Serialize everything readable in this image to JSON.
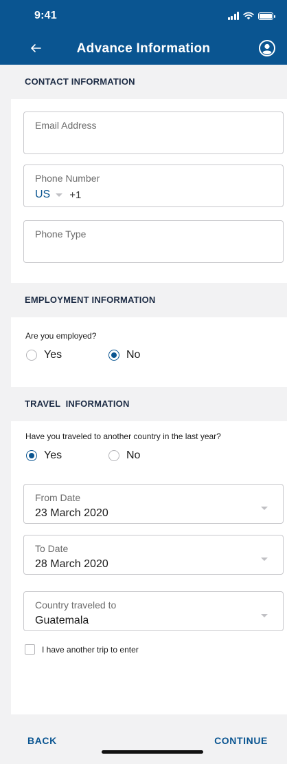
{
  "status_bar": {
    "time": "9:41"
  },
  "app_bar": {
    "title": "Advance Information"
  },
  "contact": {
    "title": "CONTACT INFORMATION",
    "email_label": "Email Address",
    "phone_label": "Phone Number",
    "country_code": "US",
    "dial_code": "+1",
    "phone_type_label": "Phone Type"
  },
  "employment": {
    "title": "EMPLOYMENT INFORMATION",
    "question": "Are you employed?",
    "options": [
      {
        "label": "Yes",
        "checked": false
      },
      {
        "label": "No",
        "checked": true
      }
    ]
  },
  "travel": {
    "title": "TRAVEL  INFORMATION",
    "question": "Have you traveled to another country in the last year?",
    "options": [
      {
        "label": "Yes",
        "checked": true
      },
      {
        "label": "No",
        "checked": false
      }
    ],
    "from_date": {
      "label": "From Date",
      "value": "23 March 2020"
    },
    "to_date": {
      "label": "To Date",
      "value": "28 March 2020"
    },
    "country": {
      "label": "Country traveled to",
      "value": "Guatemala"
    },
    "another_trip_label": "I have another trip to enter",
    "another_trip_checked": false
  },
  "footer": {
    "back_label": "BACK",
    "continue_label": "CONTINUE"
  },
  "colors": {
    "brand": "#0a5591",
    "section_bg": "#f2f2f3",
    "title_text": "#1c2b44"
  }
}
